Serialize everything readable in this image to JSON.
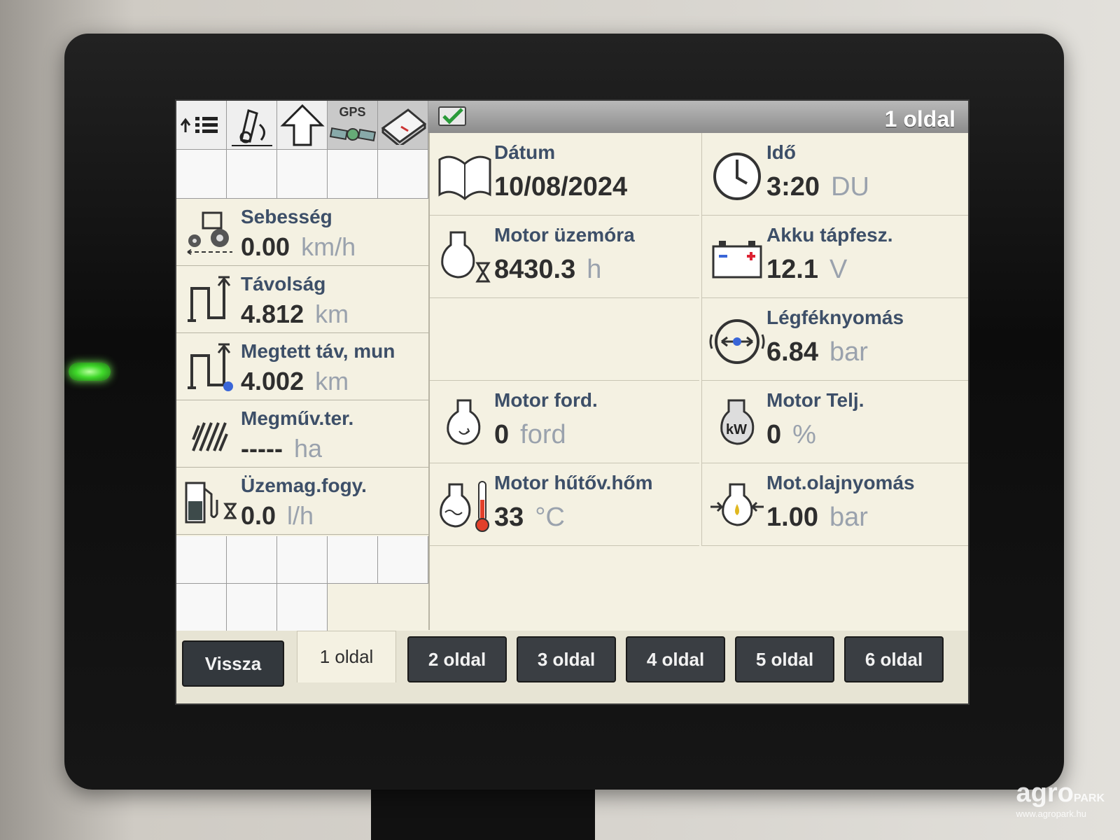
{
  "screen": {
    "header_title": "1 oldal",
    "toolbar": {
      "gps_label": "GPS"
    },
    "left_tiles": [
      {
        "label": "Sebesség",
        "value": "0.00",
        "unit": "km/h",
        "icon": "tractor-icon"
      },
      {
        "label": "Távolság",
        "value": "4.812",
        "unit": "km",
        "icon": "distance-icon"
      },
      {
        "label": "Megtett táv, mun",
        "value": "4.002",
        "unit": "km",
        "icon": "work-distance-icon"
      },
      {
        "label": "Megműv.ter.",
        "value": "-----",
        "unit": "ha",
        "icon": "area-hatch-icon"
      },
      {
        "label": "Üzemag.fogy.",
        "value": "0.0",
        "unit": "l/h",
        "icon": "fuel-pump-icon"
      }
    ],
    "tiles": [
      {
        "label": "Dátum",
        "value": "10/08/2024",
        "unit": "",
        "icon": "calendar-book-icon"
      },
      {
        "label": "Idő",
        "value": "3:20",
        "unit": "DU",
        "icon": "clock-icon"
      },
      {
        "label": "Motor üzemóra",
        "value": "8430.3",
        "unit": "h",
        "icon": "engine-hours-icon"
      },
      {
        "label": "Akku tápfesz.",
        "value": "12.1",
        "unit": "V",
        "icon": "battery-icon"
      },
      {
        "label": "Légféknyomás",
        "value": "6.84",
        "unit": "bar",
        "icon": "air-brake-icon"
      },
      {
        "label": "Motor ford.",
        "value": "0",
        "unit": "ford",
        "icon": "engine-rpm-icon"
      },
      {
        "label": "Motor Telj.",
        "value": "0",
        "unit": "%",
        "icon": "engine-power-icon"
      },
      {
        "label": "Motor hűtőv.hőm",
        "value": "33",
        "unit": "°C",
        "icon": "coolant-temp-icon"
      },
      {
        "label": "Mot.olajnyomás",
        "value": "1.00",
        "unit": "bar",
        "icon": "oil-pressure-icon"
      }
    ],
    "tabs": {
      "back": "Vissza",
      "active": "1 oldal",
      "others": [
        "2 oldal",
        "3 oldal",
        "4 oldal",
        "5 oldal",
        "6 oldal"
      ]
    }
  },
  "watermark": {
    "brand": "agro",
    "sub": "PARK",
    "url": "www.agropark.hu"
  }
}
